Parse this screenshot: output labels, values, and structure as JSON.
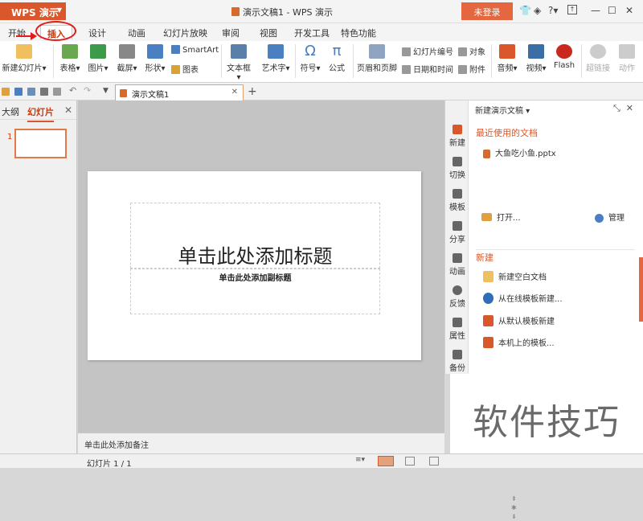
{
  "title_bar": {
    "app_button": "WPS 演示",
    "document_title": "演示文稿1 - WPS 演示",
    "login_button": "未登录",
    "help_label": "?",
    "icons": [
      "shirt-icon",
      "cube-icon",
      "help-icon",
      "window-restore-icon",
      "minimize-icon",
      "maximize-icon",
      "close-icon"
    ]
  },
  "menu": {
    "items": [
      "开始",
      "插入",
      "设计",
      "动画",
      "幻灯片放映",
      "审阅",
      "视图",
      "开发工具",
      "特色功能"
    ],
    "active": "插入"
  },
  "ribbon": {
    "new_slide": "新建幻灯片",
    "table": "表格",
    "picture": "图片",
    "screenshot": "截屏",
    "shape": "形状",
    "smartart": "SmartArt",
    "chart": "图表",
    "textbox": "文本框",
    "wordart": "艺术字",
    "symbol": "符号",
    "equation": "公式",
    "header_footer": "页眉和页脚",
    "slide_number": "幻灯片编号",
    "object": "对象",
    "date_time": "日期和时间",
    "attachment": "附件",
    "audio": "音频",
    "video": "视频",
    "flash": "Flash",
    "hyperlink": "超链接",
    "action": "动作"
  },
  "tabs": {
    "doc_tab": "演示文稿1"
  },
  "left_pane": {
    "tab_outline": "大纲",
    "tab_slides": "幻灯片",
    "slide_index": "1"
  },
  "slide": {
    "title_placeholder": "单击此处添加标题",
    "subtitle_placeholder": "单击此处添加副标题"
  },
  "notes": "单击此处添加备注",
  "status": {
    "slide_counter": "幻灯片 1 / 1"
  },
  "side_strip": [
    "新建",
    "切换",
    "模板",
    "分享",
    "动画",
    "反馈",
    "属性",
    "备份"
  ],
  "task_pane": {
    "header": "新建演示文稿",
    "recent_title": "最近使用的文档",
    "recent_files": [
      "大鱼吃小鱼.pptx"
    ],
    "open": "打开...",
    "manage": "管理",
    "new_title": "新建",
    "new_items": [
      "新建空白文档",
      "从在线模板新建...",
      "从默认模板新建",
      "本机上的模板..."
    ]
  },
  "watermark": "软件技巧",
  "colors": {
    "accent": "#d9572a",
    "annotation": "#e4191d"
  }
}
